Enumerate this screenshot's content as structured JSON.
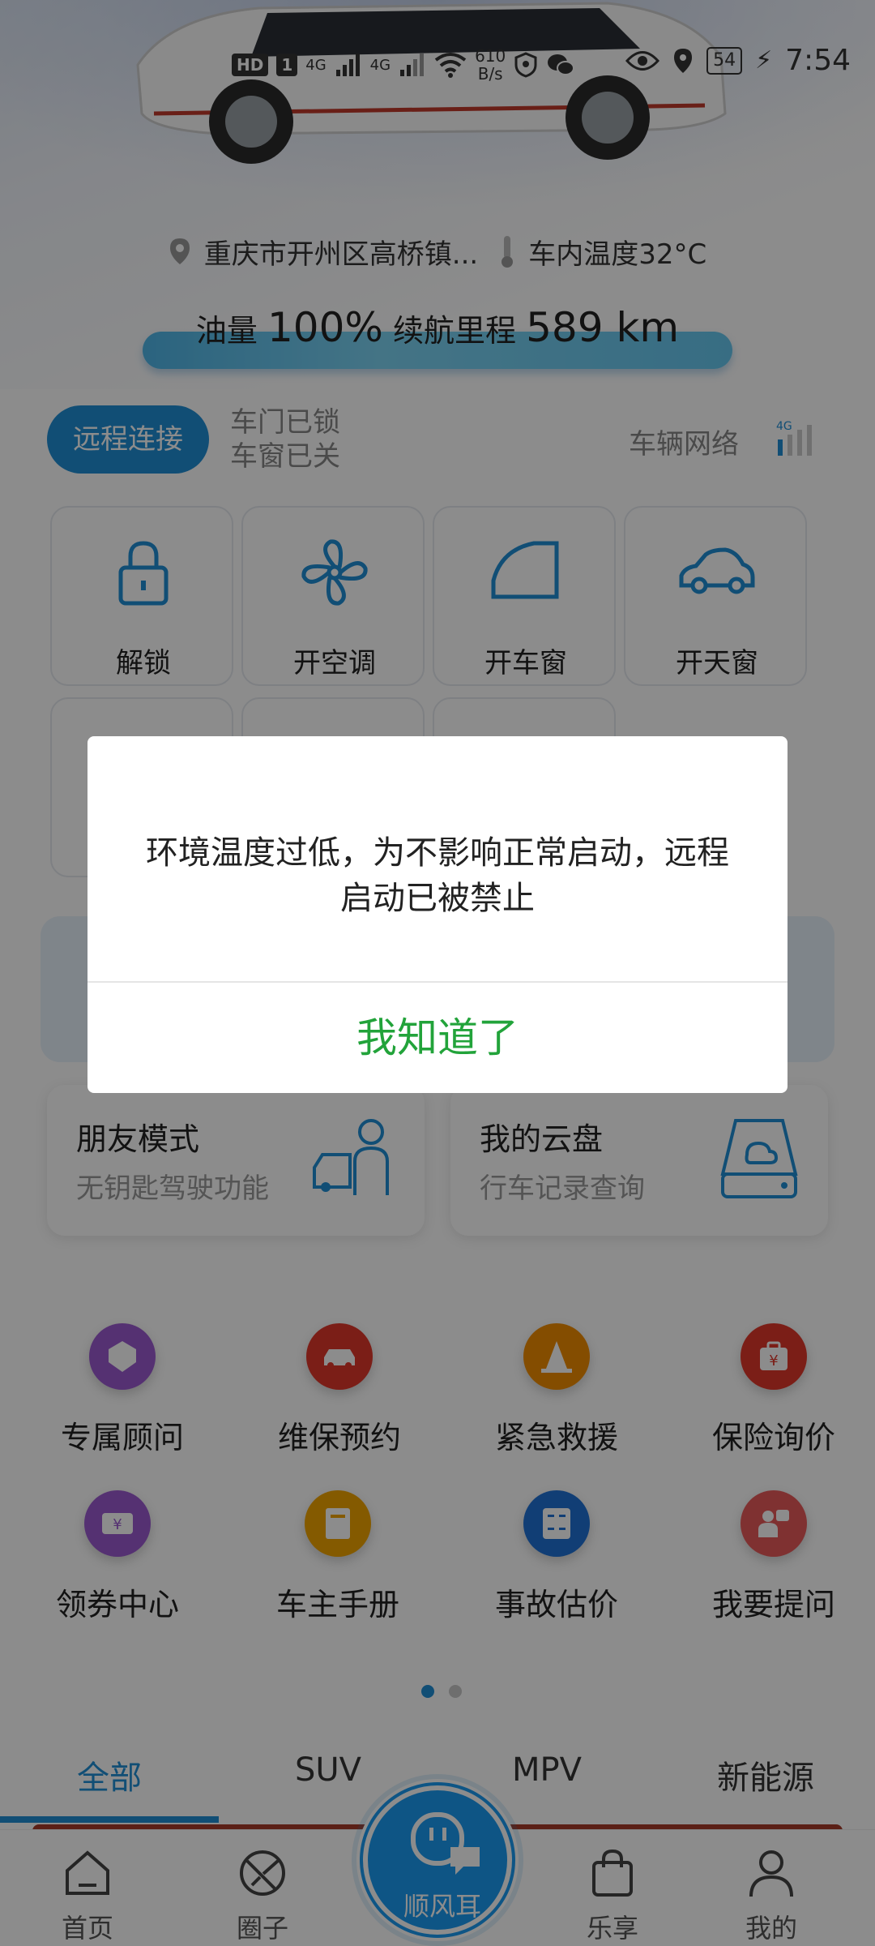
{
  "status_bar": {
    "hd": "HD",
    "sim": "1",
    "net1": "4G",
    "net2": "4G",
    "speed_value": "610",
    "speed_unit": "B/s",
    "battery": "54",
    "time": "7:54"
  },
  "vehicle": {
    "location": "重庆市开州区高桥镇...",
    "cabin_temp": "车内温度32°C",
    "fuel_label": "油量",
    "fuel_value": "100%",
    "range_label": "续航里程",
    "range_value": "589 km"
  },
  "remote": {
    "connect_label": "远程连接",
    "door_status": "车门已锁",
    "window_status": "车窗已关",
    "network_label": "车辆网络",
    "network_type": "4G"
  },
  "controls": [
    {
      "label": "解锁",
      "icon": "lock-icon"
    },
    {
      "label": "开空调",
      "icon": "fan-icon"
    },
    {
      "label": "开车窗",
      "icon": "car-window-icon"
    },
    {
      "label": "开天窗",
      "icon": "sunroof-icon"
    }
  ],
  "cards": [
    {
      "title": "朋友模式",
      "subtitle": "无钥匙驾驶功能",
      "icon": "friend-car-icon"
    },
    {
      "title": "我的云盘",
      "subtitle": "行车记录查询",
      "icon": "cloud-drive-icon"
    }
  ],
  "services": [
    {
      "label": "专属顾问",
      "icon": "advisor-icon",
      "color": "#9b59d0"
    },
    {
      "label": "维保预约",
      "icon": "maintenance-icon",
      "color": "#e0382a"
    },
    {
      "label": "紧急救援",
      "icon": "cone-icon",
      "color": "#f08c00"
    },
    {
      "label": "保险询价",
      "icon": "insurance-icon",
      "color": "#e0382a"
    },
    {
      "label": "领券中心",
      "icon": "coupon-icon",
      "color": "#9b59d0"
    },
    {
      "label": "车主手册",
      "icon": "manual-icon",
      "color": "#f0a400"
    },
    {
      "label": "事故估价",
      "icon": "calculator-icon",
      "color": "#1f72d6"
    },
    {
      "label": "我要提问",
      "icon": "question-icon",
      "color": "#e85a5a"
    }
  ],
  "category_tabs": [
    "全部",
    "SUV",
    "MPV",
    "新能源"
  ],
  "bottom_nav": [
    {
      "label": "首页",
      "icon": "home-icon"
    },
    {
      "label": "圈子",
      "icon": "circle-icon"
    },
    {
      "label": "顺风耳",
      "icon": "chat-icon"
    },
    {
      "label": "乐享",
      "icon": "bag-icon"
    },
    {
      "label": "我的",
      "icon": "profile-icon"
    }
  ],
  "dialog": {
    "message": "环境温度过低，为不影响正常启动，远程启动已被禁止",
    "ok_label": "我知道了"
  },
  "colors": {
    "accent": "#1f8fd6",
    "dialog_ok": "#22a33a"
  }
}
